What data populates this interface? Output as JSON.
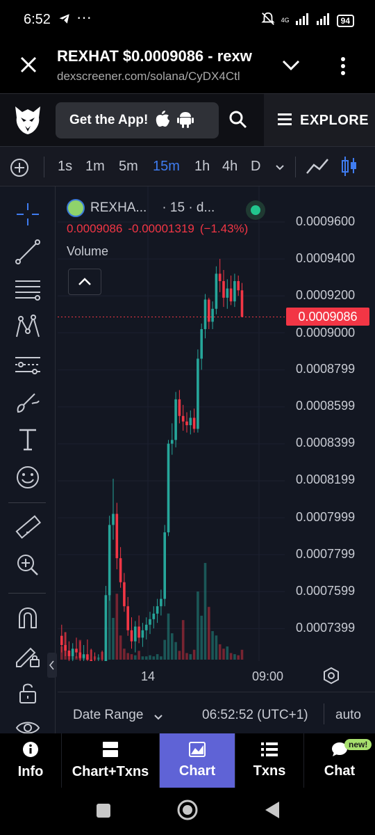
{
  "status_bar": {
    "time": "6:52",
    "dots": "···",
    "network": "4G",
    "battery": "94"
  },
  "browser": {
    "title": "REXHAT $0.0009086 - rexw",
    "url": "dexscreener.com/solana/CyDX4Ctl"
  },
  "header": {
    "get_app_label": "Get the App!",
    "explore_label": "EXPLORE"
  },
  "toolbar": {
    "timeframes": [
      "1s",
      "1m",
      "5m",
      "15m",
      "1h",
      "4h",
      "D"
    ],
    "active_timeframe": "15m"
  },
  "legend": {
    "symbol": "REXHA...",
    "interval": "· 15 · d...",
    "price": "0.0009086",
    "change": "-0.00001319",
    "change_pct": "(−1.43%)",
    "volume_label": "Volume"
  },
  "price_axis": {
    "labels": [
      "0.0009600",
      "0.0009400",
      "0.0009200",
      "0.0009000",
      "0.0008799",
      "0.0008599",
      "0.0008399",
      "0.0008199",
      "0.0007999",
      "0.0007799",
      "0.0007599",
      "0.0007399"
    ],
    "current_price": "0.0009086"
  },
  "time_axis": {
    "labels": [
      "14",
      "09:00"
    ]
  },
  "range_bar": {
    "date_range_label": "Date Range",
    "clock": "06:52:52 (UTC+1)",
    "scale_label": "auto"
  },
  "bottom_nav": {
    "items": [
      "Info",
      "Chart+Txns",
      "Chart",
      "Txns",
      "Chat"
    ],
    "active": "Chart",
    "new_badge": "new!"
  },
  "colors": {
    "up": "#26a69a",
    "down": "#f23645",
    "accent": "#3f7cf0",
    "active_tab": "#5f63d6"
  },
  "chart_data": {
    "type": "candlestick",
    "interval": "15m",
    "y_axis_ticks": [
      0.00096,
      0.00094,
      0.00092,
      0.0009,
      0.0008799,
      0.0008599,
      0.0008399,
      0.0008199,
      0.0007999,
      0.0007799,
      0.0007599,
      0.0007399
    ],
    "x_axis_ticks": [
      "14",
      "09:00"
    ],
    "last_price": 0.0009086,
    "candles": [
      {
        "o": 0.000736,
        "h": 0.000742,
        "l": 0.000727,
        "c": 0.000731
      },
      {
        "o": 0.000731,
        "h": 0.000738,
        "l": 0.000725,
        "c": 0.000728
      },
      {
        "o": 0.000728,
        "h": 0.000733,
        "l": 0.000722,
        "c": 0.000725
      },
      {
        "o": 0.000725,
        "h": 0.000732,
        "l": 0.000721,
        "c": 0.000729
      },
      {
        "o": 0.000729,
        "h": 0.000735,
        "l": 0.000724,
        "c": 0.000727
      },
      {
        "o": 0.000727,
        "h": 0.000733,
        "l": 0.000722,
        "c": 0.000724
      },
      {
        "o": 0.000724,
        "h": 0.000731,
        "l": 0.00072,
        "c": 0.000726
      },
      {
        "o": 0.000726,
        "h": 0.000734,
        "l": 0.000722,
        "c": 0.000723
      },
      {
        "o": 0.000723,
        "h": 0.000729,
        "l": 0.000718,
        "c": 0.000721
      },
      {
        "o": 0.000721,
        "h": 0.000727,
        "l": 0.000716,
        "c": 0.000719
      },
      {
        "o": 0.000719,
        "h": 0.000726,
        "l": 0.000715,
        "c": 0.000722
      },
      {
        "o": 0.000722,
        "h": 0.000728,
        "l": 0.000717,
        "c": 0.000718
      },
      {
        "o": 0.000718,
        "h": 0.000763,
        "l": 0.000716,
        "c": 0.000758
      },
      {
        "o": 0.000758,
        "h": 0.000801,
        "l": 0.000755,
        "c": 0.000796
      },
      {
        "o": 0.000796,
        "h": 0.000821,
        "l": 0.000788,
        "c": 0.000802
      },
      {
        "o": 0.000802,
        "h": 0.000808,
        "l": 0.000772,
        "c": 0.000778
      },
      {
        "o": 0.000778,
        "h": 0.000784,
        "l": 0.000762,
        "c": 0.000765
      },
      {
        "o": 0.000765,
        "h": 0.00077,
        "l": 0.000749,
        "c": 0.000752
      },
      {
        "o": 0.000752,
        "h": 0.000757,
        "l": 0.000736,
        "c": 0.000739
      },
      {
        "o": 0.000739,
        "h": 0.000746,
        "l": 0.000729,
        "c": 0.000733
      },
      {
        "o": 0.000733,
        "h": 0.000744,
        "l": 0.000727,
        "c": 0.000741
      },
      {
        "o": 0.000741,
        "h": 0.000747,
        "l": 0.000732,
        "c": 0.000735
      },
      {
        "o": 0.000735,
        "h": 0.000743,
        "l": 0.00073,
        "c": 0.000739
      },
      {
        "o": 0.000739,
        "h": 0.000746,
        "l": 0.000734,
        "c": 0.000742
      },
      {
        "o": 0.000742,
        "h": 0.000749,
        "l": 0.000737,
        "c": 0.000745
      },
      {
        "o": 0.000745,
        "h": 0.000752,
        "l": 0.00074,
        "c": 0.000748
      },
      {
        "o": 0.000748,
        "h": 0.000756,
        "l": 0.000743,
        "c": 0.000752
      },
      {
        "o": 0.000752,
        "h": 0.000761,
        "l": 0.000747,
        "c": 0.000756
      },
      {
        "o": 0.000756,
        "h": 0.000796,
        "l": 0.000752,
        "c": 0.000792
      },
      {
        "o": 0.000792,
        "h": 0.000842,
        "l": 0.00079,
        "c": 0.00084
      },
      {
        "o": 0.00084,
        "h": 0.000851,
        "l": 0.000834,
        "c": 0.000842
      },
      {
        "o": 0.000842,
        "h": 0.000868,
        "l": 0.000838,
        "c": 0.000864
      },
      {
        "o": 0.000864,
        "h": 0.000869,
        "l": 0.000851,
        "c": 0.000855
      },
      {
        "o": 0.000855,
        "h": 0.000861,
        "l": 0.000847,
        "c": 0.000852
      },
      {
        "o": 0.000852,
        "h": 0.000857,
        "l": 0.000846,
        "c": 0.00085
      },
      {
        "o": 0.00085,
        "h": 0.000858,
        "l": 0.000845,
        "c": 0.000854
      },
      {
        "o": 0.000854,
        "h": 0.000859,
        "l": 0.000846,
        "c": 0.000848
      },
      {
        "o": 0.000848,
        "h": 0.000891,
        "l": 0.000846,
        "c": 0.000886
      },
      {
        "o": 0.000886,
        "h": 0.000905,
        "l": 0.00088,
        "c": 0.000902
      },
      {
        "o": 0.000902,
        "h": 0.000921,
        "l": 0.000897,
        "c": 0.000918
      },
      {
        "o": 0.000918,
        "h": 0.000919,
        "l": 0.000902,
        "c": 0.000906
      },
      {
        "o": 0.000906,
        "h": 0.000917,
        "l": 0.000902,
        "c": 0.000913
      },
      {
        "o": 0.000913,
        "h": 0.000936,
        "l": 0.00091,
        "c": 0.000932
      },
      {
        "o": 0.000932,
        "h": 0.00094,
        "l": 0.000922,
        "c": 0.000928
      },
      {
        "o": 0.000928,
        "h": 0.000934,
        "l": 0.000914,
        "c": 0.000919
      },
      {
        "o": 0.000919,
        "h": 0.000929,
        "l": 0.000913,
        "c": 0.000924
      },
      {
        "o": 0.000924,
        "h": 0.000931,
        "l": 0.000915,
        "c": 0.000917
      },
      {
        "o": 0.000917,
        "h": 0.000932,
        "l": 0.000914,
        "c": 0.000928
      },
      {
        "o": 0.000928,
        "h": 0.000931,
        "l": 0.00092,
        "c": 0.000923
      },
      {
        "o": 0.000923,
        "h": 0.000927,
        "l": 0.000909,
        "c": 0.0009086
      }
    ],
    "volumes": [
      12,
      25,
      6,
      4,
      3,
      18,
      3,
      2,
      9,
      3,
      2,
      7,
      30,
      95,
      38,
      60,
      22,
      10,
      6,
      5,
      4,
      8,
      3,
      3,
      4,
      3,
      5,
      3,
      18,
      42,
      24,
      16,
      8,
      36,
      6,
      5,
      9,
      62,
      40,
      88,
      48,
      26,
      22,
      14,
      10,
      12,
      6,
      5,
      4,
      9
    ]
  }
}
